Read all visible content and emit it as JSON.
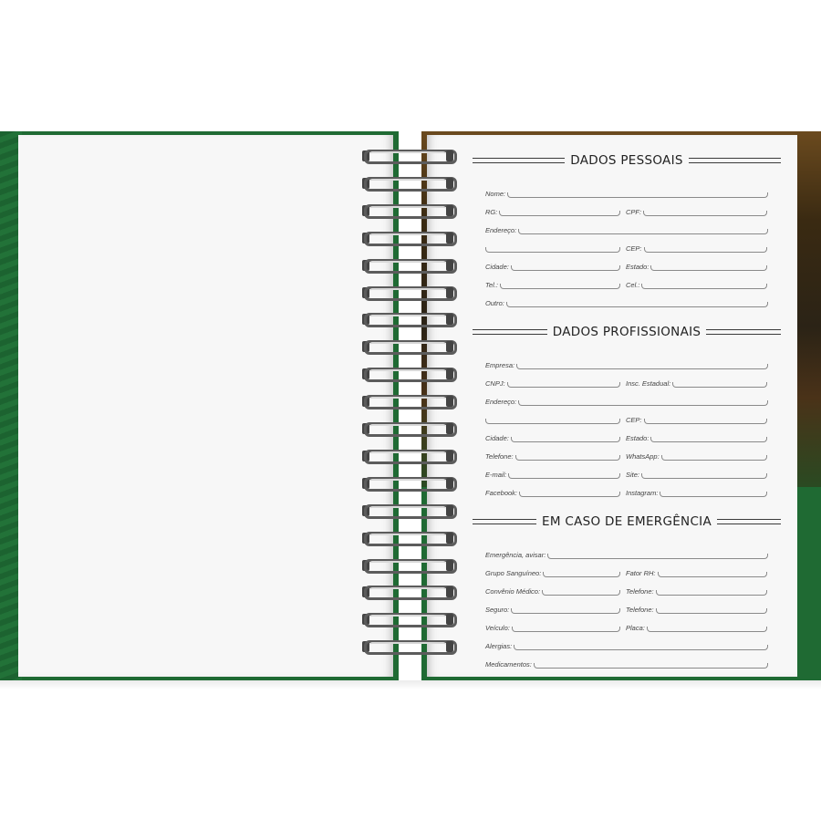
{
  "colors": {
    "cover_green": "#1f6a33",
    "page": "#f7f7f7",
    "ink": "#222222"
  },
  "spiral": {
    "coil_count": 19
  },
  "dados_pessoais": {
    "title": "DADOS PESSOAIS",
    "nome": "Nome:",
    "rg": "RG:",
    "cpf": "CPF:",
    "endereco": "Endereço:",
    "cep": "CEP:",
    "cidade": "Cidade:",
    "estado": "Estado:",
    "tel": "Tel.:",
    "cel": "Cel.:",
    "outro": "Outro:"
  },
  "dados_profissionais": {
    "title": "DADOS PROFISSIONAIS",
    "empresa": "Empresa:",
    "cnpj": "CNPJ:",
    "insc_estadual": "Insc. Estadual:",
    "endereco": "Endereço:",
    "cep": "CEP:",
    "cidade": "Cidade:",
    "estado": "Estado:",
    "telefone": "Telefone:",
    "whatsapp": "WhatsApp:",
    "email": "E-mail:",
    "site": "Site:",
    "facebook": "Facebook:",
    "instagram": "Instagram:"
  },
  "emergencia": {
    "title": "EM CASO DE EMERGÊNCIA",
    "avisar": "Emergência, avisar:",
    "grupo": "Grupo Sanguíneo:",
    "fator": "Fator RH:",
    "convenio": "Convênio Médico:",
    "telefone1": "Telefone:",
    "seguro": "Seguro:",
    "telefone2": "Telefone:",
    "veiculo": "Veículo:",
    "placa": "Placa:",
    "alergias": "Alergias:",
    "medicamentos": "Medicamentos:"
  }
}
